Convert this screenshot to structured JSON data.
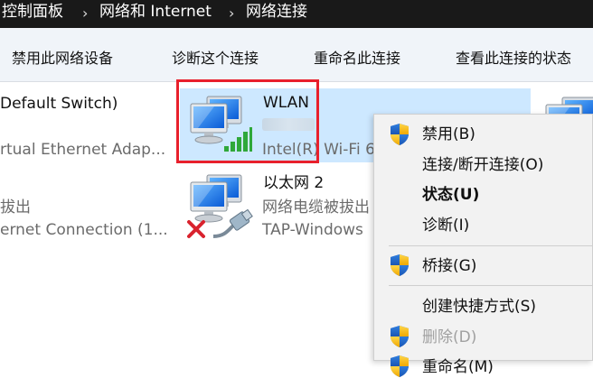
{
  "breadcrumb": {
    "items": [
      "控制面板",
      "网络和 Internet",
      "网络连接"
    ],
    "separator": "›"
  },
  "toolbar": {
    "buttons": [
      "禁用此网络设备",
      "诊断这个连接",
      "重命名此连接",
      "查看此连接的状态"
    ]
  },
  "adapters": {
    "default_switch": {
      "name": "Default Switch)",
      "desc": "rtual Ethernet Adap..."
    },
    "left_second": {
      "status": "拔出",
      "desc": "ernet Connection (1..."
    },
    "wlan": {
      "name": "WLAN",
      "desc": "Intel(R) Wi-Fi 6"
    },
    "ethernet2": {
      "name": "以太网 2",
      "status": "网络电缆被拔出",
      "desc": "TAP-Windows"
    }
  },
  "context_menu": {
    "items": [
      {
        "label": "禁用(B)",
        "shield": true
      },
      {
        "label": "连接/断开连接(O)"
      },
      {
        "label": "状态(U)",
        "bold": true
      },
      {
        "label": "诊断(I)"
      },
      {
        "label": "桥接(G)",
        "shield": true
      },
      {
        "label": "创建快捷方式(S)"
      },
      {
        "label": "删除(D)",
        "shield": true,
        "disabled": true
      },
      {
        "label": "重命名(M)",
        "shield": true
      }
    ]
  },
  "colors": {
    "address_bar": "#191919",
    "toolbar": "#f0f4f9",
    "selection": "#cde8ff",
    "highlight_box": "#e8202c",
    "signal_green": "#2fa83a",
    "disconnected_x": "#d9232e"
  }
}
